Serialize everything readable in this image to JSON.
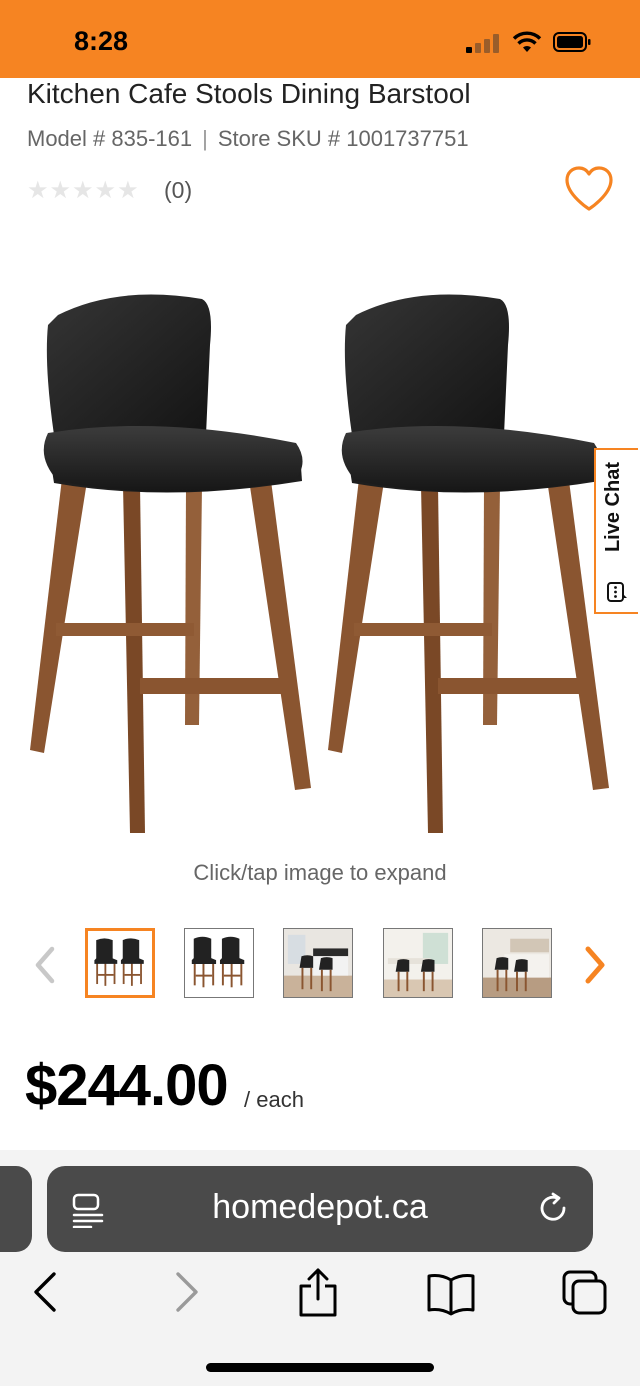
{
  "status_bar": {
    "time": "8:28"
  },
  "product": {
    "title": "Kitchen Cafe Stools Dining Barstool",
    "model_label": "Model # 835-161",
    "sku_label": "Store SKU # 1001737751",
    "separator": "|",
    "stars": "★★★★★",
    "rating": 0,
    "review_count": "(0)"
  },
  "live_chat": {
    "label": "Live Chat"
  },
  "image": {
    "expand_hint": "Click/tap image to expand"
  },
  "thumbnails": [
    {
      "name": "thumbnail-1",
      "active": true
    },
    {
      "name": "thumbnail-2",
      "active": false
    },
    {
      "name": "thumbnail-3",
      "active": false
    },
    {
      "name": "thumbnail-4",
      "active": false
    },
    {
      "name": "thumbnail-5",
      "active": false
    }
  ],
  "price": {
    "amount": "$244.00",
    "unit": "/ each"
  },
  "browser": {
    "url": "homedepot.ca"
  },
  "colors": {
    "brand": "#f68422",
    "url_bar": "#4a4a4a"
  }
}
